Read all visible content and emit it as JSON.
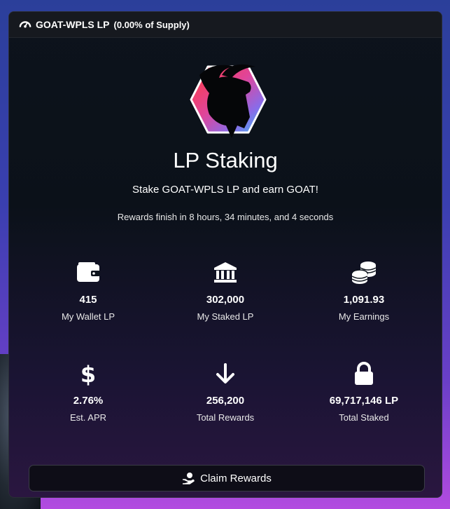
{
  "header": {
    "title": "GOAT-WPLS LP",
    "subtitle": "(0.00% of Supply)",
    "icon": "gauge-icon"
  },
  "hero": {
    "logo": "goat-logo",
    "title": "LP Staking",
    "subtitle": "Stake GOAT-WPLS LP and earn GOAT!",
    "countdown": "Rewards finish in 8 hours, 34 minutes, and 4 seconds"
  },
  "stats": [
    {
      "icon": "wallet-icon",
      "value": "415",
      "label": "My Wallet LP"
    },
    {
      "icon": "bank-icon",
      "value": "302,000",
      "label": "My Staked LP"
    },
    {
      "icon": "coins-icon",
      "value": "1,091.93",
      "label": "My Earnings"
    },
    {
      "icon": "dollar-icon",
      "value": "2.76%",
      "label": "Est. APR"
    },
    {
      "icon": "arrow-down-icon",
      "value": "256,200",
      "label": "Total Rewards"
    },
    {
      "icon": "lock-icon",
      "value": "69,717,146 LP",
      "label": "Total Staked"
    }
  ],
  "claim_button": {
    "label": "Claim Rewards",
    "icon": "hand-coin-icon"
  }
}
